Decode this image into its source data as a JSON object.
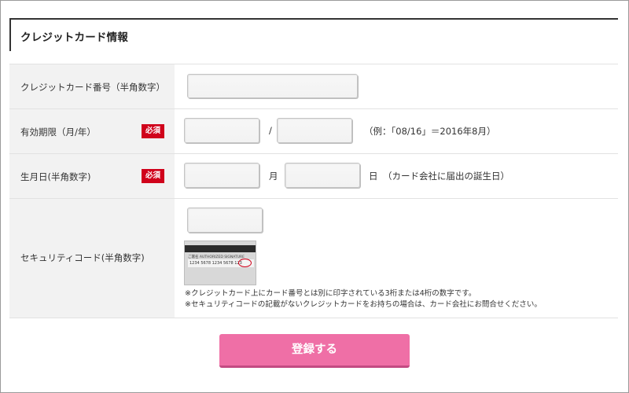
{
  "section_title": "クレジットカード情報",
  "required_badge": "必須",
  "rows": {
    "card_number": {
      "label": "クレジットカード番号（半角数字）"
    },
    "expiry": {
      "label": "有効期限（月/年）",
      "separator": "/",
      "hint": "（例：「08/16」＝2016年8月）"
    },
    "birthday": {
      "label": "生月日(半角数字)",
      "month_unit": "月",
      "day_unit": "日",
      "hint": "（カード会社に届出の誕生日）"
    },
    "security_code": {
      "label": "セキュリティコード(半角数字)",
      "card_signature_label": "ご署名 AUTHORIZED SIGNATURE",
      "card_numbers": "1234 5678  1234 5678  123",
      "note1": "※クレジットカード上にカード番号とは別に印字されている3桁または4桁の数字です。",
      "note2": "※セキュリティコードの記載がないクレジットカードをお持ちの場合は、カード会社にお問合せください。"
    }
  },
  "submit_label": "登録する",
  "colors": {
    "required_badge": "#d0021b",
    "submit_button": "#ef6fa6",
    "label_background": "#f2f2f2"
  }
}
